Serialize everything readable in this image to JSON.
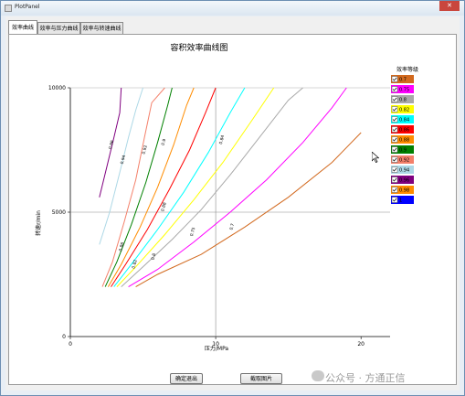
{
  "window": {
    "title": "PlotPanel",
    "close_glyph": "✕"
  },
  "tabs": [
    "效率曲线",
    "效率与压力曲线",
    "效率与转速曲线"
  ],
  "buttons": {
    "ok": "确定退出",
    "save": "截取图片"
  },
  "watermark": "公众号 · 方通正信",
  "chart_data": {
    "type": "line",
    "title": "容积效率曲线图",
    "xlabel": "压力/MPa",
    "ylabel": "转速r/min",
    "xlim": [
      0,
      22
    ],
    "ylim": [
      0,
      10000
    ],
    "x_ticks": [
      "0",
      "10",
      "20"
    ],
    "y_ticks": [
      "0",
      "5000",
      "10000"
    ],
    "grid": "crosshair at x=10 and y=5000",
    "legend_title": "效率等级",
    "legend_position": "right",
    "series": [
      {
        "name": "0.7",
        "color": "#d2691e",
        "points": [
          [
            4.5,
            2000
          ],
          [
            6,
            2500
          ],
          [
            9,
            3300
          ],
          [
            12,
            4400
          ],
          [
            15,
            5600
          ],
          [
            18,
            7000
          ],
          [
            20,
            8200
          ]
        ]
      },
      {
        "name": "0.75",
        "color": "#ff00ff",
        "points": [
          [
            4,
            2000
          ],
          [
            6,
            2700
          ],
          [
            8.5,
            3800
          ],
          [
            11,
            5000
          ],
          [
            13.5,
            6300
          ],
          [
            16,
            7800
          ],
          [
            18,
            9200
          ],
          [
            19,
            10000
          ]
        ]
      },
      {
        "name": "0.8",
        "color": "#a9a9a9",
        "points": [
          [
            3.5,
            2000
          ],
          [
            5,
            2800
          ],
          [
            7,
            3900
          ],
          [
            9,
            5100
          ],
          [
            11,
            6500
          ],
          [
            13,
            8000
          ],
          [
            15,
            9500
          ],
          [
            16,
            10000
          ]
        ]
      },
      {
        "name": "0.82",
        "color": "#ffff00",
        "points": [
          [
            3.2,
            2000
          ],
          [
            4.5,
            2800
          ],
          [
            6.5,
            4100
          ],
          [
            8.5,
            5500
          ],
          [
            10.5,
            7000
          ],
          [
            12.5,
            8700
          ],
          [
            14,
            10000
          ]
        ]
      },
      {
        "name": "0.84",
        "color": "#00ffff",
        "points": [
          [
            3,
            2000
          ],
          [
            4.2,
            2900
          ],
          [
            6,
            4300
          ],
          [
            7.8,
            5800
          ],
          [
            9.5,
            7400
          ],
          [
            11,
            9000
          ],
          [
            12,
            10000
          ]
        ]
      },
      {
        "name": "0.86",
        "color": "#ff0000",
        "points": [
          [
            2.8,
            2000
          ],
          [
            3.8,
            2900
          ],
          [
            5.3,
            4300
          ],
          [
            6.8,
            5900
          ],
          [
            8.2,
            7500
          ],
          [
            9.3,
            9000
          ],
          [
            10,
            10000
          ]
        ]
      },
      {
        "name": "0.88",
        "color": "#ff8c00",
        "points": [
          [
            2.6,
            2000
          ],
          [
            3.5,
            2900
          ],
          [
            4.8,
            4400
          ],
          [
            6,
            6000
          ],
          [
            7.1,
            7700
          ],
          [
            8,
            9300
          ],
          [
            8.5,
            10000
          ]
        ]
      },
      {
        "name": "0.9",
        "color": "#008000",
        "points": [
          [
            2.4,
            2000
          ],
          [
            3.2,
            3000
          ],
          [
            4.2,
            4500
          ],
          [
            5.2,
            6200
          ],
          [
            6,
            7800
          ],
          [
            6.7,
            9300
          ],
          [
            7,
            10000
          ]
        ]
      },
      {
        "name": "0.92",
        "color": "#f4806a",
        "points": [
          [
            2.2,
            2000
          ],
          [
            2.9,
            3000
          ],
          [
            3.7,
            4600
          ],
          [
            4.5,
            6300
          ],
          [
            5.1,
            8000
          ],
          [
            5.6,
            9400
          ],
          [
            6.5,
            10000
          ]
        ]
      },
      {
        "name": "0.94",
        "color": "#add8e6",
        "points": [
          [
            2,
            3700
          ],
          [
            2.7,
            5000
          ],
          [
            3.4,
            6600
          ],
          [
            4,
            8000
          ],
          [
            4.5,
            9100
          ],
          [
            5,
            10000
          ]
        ]
      },
      {
        "name": "0.96",
        "color": "#800080",
        "points": [
          [
            2,
            5600
          ],
          [
            2.5,
            6800
          ],
          [
            3,
            8000
          ],
          [
            3.4,
            9000
          ],
          [
            3.5,
            10000
          ]
        ]
      },
      {
        "name": "0.98",
        "color": "#ff8c00",
        "points": []
      },
      {
        "name": "1",
        "color": "#0000ff",
        "points": []
      }
    ],
    "curve_labels": [
      {
        "text": "0.7",
        "at": [
          11.2,
          4400
        ]
      },
      {
        "text": "0.75",
        "at": [
          8.5,
          4200
        ]
      },
      {
        "text": "0.8",
        "at": [
          5.8,
          3200
        ]
      },
      {
        "text": "0.82",
        "at": [
          4.5,
          2900
        ]
      },
      {
        "text": "0.84",
        "at": [
          10.5,
          7900
        ]
      },
      {
        "text": "0.86",
        "at": [
          3.6,
          3600
        ]
      },
      {
        "text": "0.88",
        "at": [
          6.5,
          5200
        ]
      },
      {
        "text": "0.9",
        "at": [
          6.5,
          7800
        ]
      },
      {
        "text": "0.92",
        "at": [
          5.2,
          7500
        ]
      },
      {
        "text": "0.94",
        "at": [
          3.7,
          7100
        ]
      },
      {
        "text": "0.96",
        "at": [
          2.9,
          7700
        ]
      }
    ]
  }
}
